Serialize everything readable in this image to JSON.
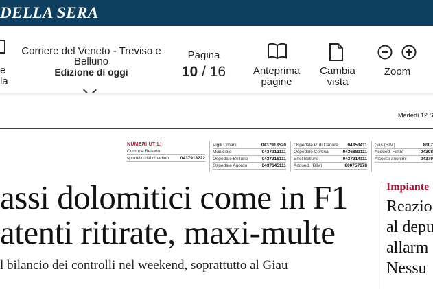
{
  "brand": {
    "masthead": "DELLA SERA"
  },
  "toolbar": {
    "menu_label_1": "e",
    "menu_label_2": "la",
    "edition_title": "Corriere del Veneto - Treviso e Belluno",
    "edition_subtitle": "Edizione di oggi",
    "page_label": "Pagina",
    "page_current": "10",
    "page_separator": " / ",
    "page_total": "16",
    "preview_label_1": "Anteprima",
    "preview_label_2": "pagine",
    "view_label_1": "Cambia",
    "view_label_2": "vista",
    "zoom_label": "Zoom"
  },
  "page": {
    "date": "Martedì 12 S",
    "numeri_utili": {
      "title": "NUMERI UTILI",
      "col1": [
        {
          "label": "Comune Belluno",
          "value": ""
        },
        {
          "label": "sportello del cittadino",
          "value": "0437913222"
        }
      ],
      "col2": [
        {
          "label": "Vigili Urbani",
          "value": "0437913520"
        },
        {
          "label": "Municipio",
          "value": "0437913111"
        },
        {
          "label": "Ospedale Belluno",
          "value": "0437216111"
        },
        {
          "label": "Ospedale Agordo",
          "value": "0437645111"
        }
      ],
      "col3": [
        {
          "label": "Ospedale P. di Cadore",
          "value": "04353411"
        },
        {
          "label": "Ospedale Cortina",
          "value": "0436883111"
        },
        {
          "label": "Enel Belluno",
          "value": "0437214111"
        },
        {
          "label": "Acqued. (BIM)",
          "value": "800757678"
        }
      ],
      "col4": [
        {
          "label": "Gas (BIM)",
          "value": "8007"
        },
        {
          "label": "Acqued. Feltre",
          "value": "04398"
        },
        {
          "label": "Alcolisti anonimi",
          "value": "04379"
        }
      ]
    },
    "headline_line1": "assi dolomitici come in F1",
    "headline_line2": "atenti ritirate, maxi-multe",
    "subheadline": "l bilancio dei controlli nel weekend, soprattutto al Giau",
    "side": {
      "kicker": "Impiante",
      "lines": [
        "Reazio",
        "al depu",
        "allarm",
        "Nessu"
      ]
    }
  }
}
